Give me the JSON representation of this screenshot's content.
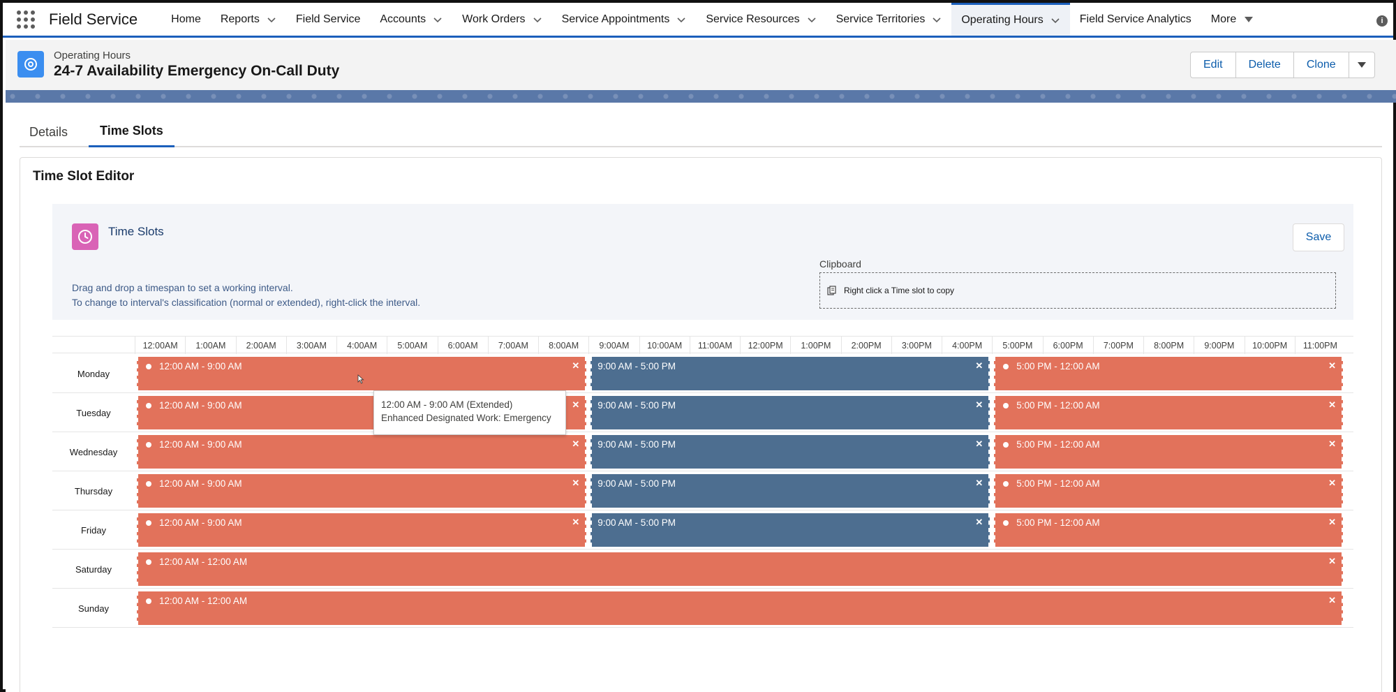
{
  "app": {
    "name": "Field Service",
    "nav_items": [
      {
        "label": "Home",
        "has_chevron": false
      },
      {
        "label": "Reports",
        "has_chevron": true
      },
      {
        "label": "Field Service",
        "has_chevron": false
      },
      {
        "label": "Accounts",
        "has_chevron": true
      },
      {
        "label": "Work Orders",
        "has_chevron": true
      },
      {
        "label": "Service Appointments",
        "has_chevron": true
      },
      {
        "label": "Service Resources",
        "has_chevron": true
      },
      {
        "label": "Service Territories",
        "has_chevron": true
      },
      {
        "label": "Operating Hours",
        "has_chevron": true,
        "active": true
      },
      {
        "label": "Field Service Analytics",
        "has_chevron": false
      },
      {
        "label": "More",
        "has_caret": true
      }
    ]
  },
  "record": {
    "type": "Operating Hours",
    "title": "24-7 Availability Emergency On-Call Duty",
    "actions": [
      "Edit",
      "Delete",
      "Clone"
    ]
  },
  "tabs": [
    {
      "label": "Details",
      "active": false
    },
    {
      "label": "Time Slots",
      "active": true
    }
  ],
  "editor": {
    "title": "Time Slot Editor",
    "panel_title": "Time Slots",
    "save_label": "Save",
    "instructions": [
      "Drag and drop a timespan to set a working interval.",
      "To change to interval's classification (normal or extended), right-click the interval."
    ],
    "clipboard_label": "Clipboard",
    "clipboard_hint": "Right click a Time slot to copy"
  },
  "hours": [
    "12:00AM",
    "1:00AM",
    "2:00AM",
    "3:00AM",
    "4:00AM",
    "5:00AM",
    "6:00AM",
    "7:00AM",
    "8:00AM",
    "9:00AM",
    "10:00AM",
    "11:00AM",
    "12:00PM",
    "1:00PM",
    "2:00PM",
    "3:00PM",
    "4:00PM",
    "5:00PM",
    "6:00PM",
    "7:00PM",
    "8:00PM",
    "9:00PM",
    "10:00PM",
    "11:00PM"
  ],
  "days": [
    {
      "name": "Monday",
      "slots": [
        {
          "label": "12:00 AM - 9:00 AM",
          "start": 0,
          "end": 9,
          "type": "extended"
        },
        {
          "label": "9:00 AM - 5:00 PM",
          "start": 9,
          "end": 17,
          "type": "normal"
        },
        {
          "label": "5:00 PM - 12:00 AM",
          "start": 17,
          "end": 24,
          "type": "extended"
        }
      ]
    },
    {
      "name": "Tuesday",
      "slots": [
        {
          "label": "12:00 AM - 9:00 AM",
          "start": 0,
          "end": 9,
          "type": "extended"
        },
        {
          "label": "9:00 AM - 5:00 PM",
          "start": 9,
          "end": 17,
          "type": "normal"
        },
        {
          "label": "5:00 PM - 12:00 AM",
          "start": 17,
          "end": 24,
          "type": "extended"
        }
      ]
    },
    {
      "name": "Wednesday",
      "slots": [
        {
          "label": "12:00 AM - 9:00 AM",
          "start": 0,
          "end": 9,
          "type": "extended"
        },
        {
          "label": "9:00 AM - 5:00 PM",
          "start": 9,
          "end": 17,
          "type": "normal"
        },
        {
          "label": "5:00 PM - 12:00 AM",
          "start": 17,
          "end": 24,
          "type": "extended"
        }
      ]
    },
    {
      "name": "Thursday",
      "slots": [
        {
          "label": "12:00 AM - 9:00 AM",
          "start": 0,
          "end": 9,
          "type": "extended"
        },
        {
          "label": "9:00 AM - 5:00 PM",
          "start": 9,
          "end": 17,
          "type": "normal"
        },
        {
          "label": "5:00 PM - 12:00 AM",
          "start": 17,
          "end": 24,
          "type": "extended"
        }
      ]
    },
    {
      "name": "Friday",
      "slots": [
        {
          "label": "12:00 AM - 9:00 AM",
          "start": 0,
          "end": 9,
          "type": "extended"
        },
        {
          "label": "9:00 AM - 5:00 PM",
          "start": 9,
          "end": 17,
          "type": "normal"
        },
        {
          "label": "5:00 PM - 12:00 AM",
          "start": 17,
          "end": 24,
          "type": "extended"
        }
      ]
    },
    {
      "name": "Saturday",
      "slots": [
        {
          "label": "12:00 AM - 12:00 AM",
          "start": 0,
          "end": 24,
          "type": "extended"
        }
      ]
    },
    {
      "name": "Sunday",
      "slots": [
        {
          "label": "12:00 AM - 12:00 AM",
          "start": 0,
          "end": 24,
          "type": "extended"
        }
      ]
    }
  ],
  "tooltip": {
    "line1": "12:00 AM - 9:00 AM (Extended)",
    "line2": "Enhanced Designated Work: Emergency"
  },
  "colors": {
    "extended": "#e2725b",
    "normal": "#4d6e90",
    "brand": "#1b5fbb"
  },
  "icons": {
    "app_launcher": "waffle-icon",
    "record": "operating-hours-icon",
    "time_slots": "clock-icon",
    "clipboard": "copy-icon",
    "remove": "close-icon"
  }
}
